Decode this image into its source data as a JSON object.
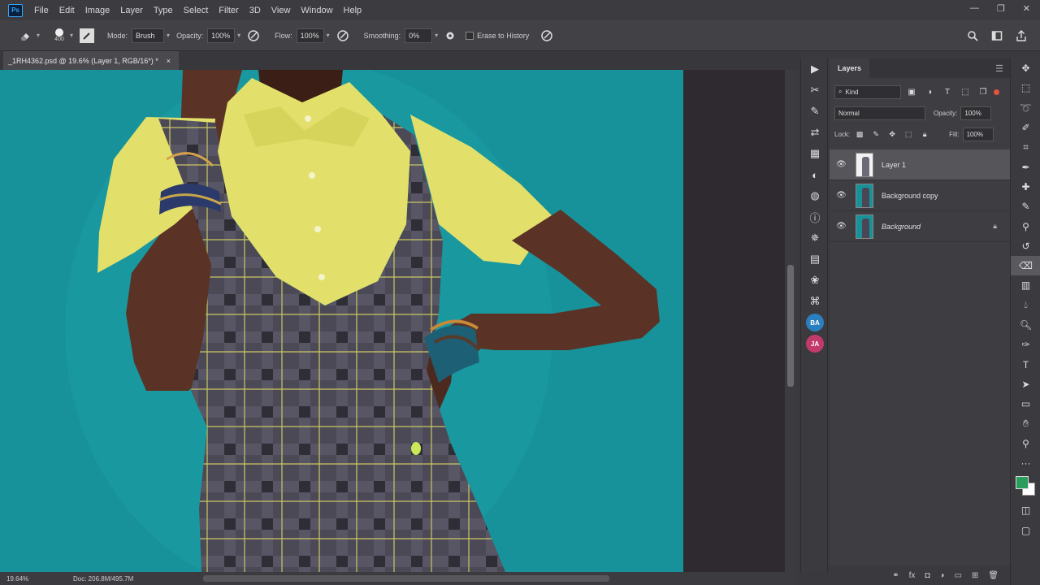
{
  "menubar": {
    "logo": "Ps",
    "items": [
      "File",
      "Edit",
      "Image",
      "Layer",
      "Type",
      "Select",
      "Filter",
      "3D",
      "View",
      "Window",
      "Help"
    ],
    "window_controls": [
      "—",
      "❐",
      "✕"
    ]
  },
  "options": {
    "brush_size": "400",
    "mode_label": "Mode:",
    "mode_value": "Brush",
    "opacity_label": "Opacity:",
    "opacity_value": "100%",
    "flow_label": "Flow:",
    "flow_value": "100%",
    "smoothing_label": "Smoothing:",
    "smoothing_value": "0%",
    "erase_history_label": "Erase to History"
  },
  "document": {
    "tab_title": "_1RH4362.psd @ 19.6% (Layer 1, RGB/16*) *",
    "close_glyph": "×"
  },
  "status": {
    "zoom": "19.64%",
    "doc_info": "Doc: 206.8M/495.7M"
  },
  "layers_panel": {
    "tab_label": "Layers",
    "filter_kind": "Kind",
    "blend_mode": "Normal",
    "opacity_label": "Opacity:",
    "opacity_value": "100%",
    "lock_label": "Lock:",
    "fill_label": "Fill:",
    "fill_value": "100%",
    "layers": [
      {
        "name": "Layer 1",
        "selected": true,
        "locked": false
      },
      {
        "name": "Background copy",
        "selected": false,
        "locked": false
      },
      {
        "name": "Background",
        "selected": false,
        "locked": true
      }
    ]
  },
  "colors": {
    "photo_background": "#17929a",
    "shirt": "#e2e06a",
    "skin": "#5a3326",
    "dress": "#4b4856",
    "foreground_swatch": "#2a9d5c",
    "background_swatch": "#ffffff"
  },
  "tools": [
    "move-icon",
    "marquee-icon",
    "lasso-icon",
    "quick-select-icon",
    "crop-icon",
    "eyedropper-icon",
    "healing-icon",
    "brush-icon",
    "clone-stamp-icon",
    "history-brush-icon",
    "eraser-icon",
    "gradient-icon",
    "blur-icon",
    "dodge-icon",
    "pen-icon",
    "type-icon",
    "path-select-icon",
    "rectangle-icon",
    "hand-icon",
    "zoom-icon",
    "more-tools-icon"
  ]
}
